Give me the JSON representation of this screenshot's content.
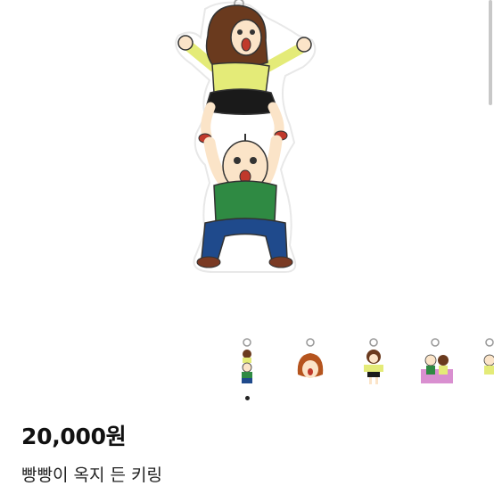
{
  "product": {
    "price": "20,000원",
    "title": "빵빵이 옥지 든 키링",
    "subtitle": ""
  },
  "gallery": {
    "main_image": "keyring-illustration",
    "thumbnails": [
      {
        "name": "thumbnail-stacked-keyring",
        "selected": true
      },
      {
        "name": "thumbnail-face-keyring",
        "selected": false
      },
      {
        "name": "thumbnail-girl-keyring",
        "selected": false
      },
      {
        "name": "thumbnail-bench-keyring",
        "selected": false
      },
      {
        "name": "thumbnail-partial-keyring",
        "selected": false
      }
    ],
    "current_page": 1
  },
  "colors": {
    "shirt_yellow": "#e4eb78",
    "shirt_green": "#2f8a43",
    "pants_blue": "#1f4a8c",
    "hair_brown": "#6a3a1e",
    "skin": "#fbe4c8",
    "shoe_brown": "#7a3a24"
  }
}
